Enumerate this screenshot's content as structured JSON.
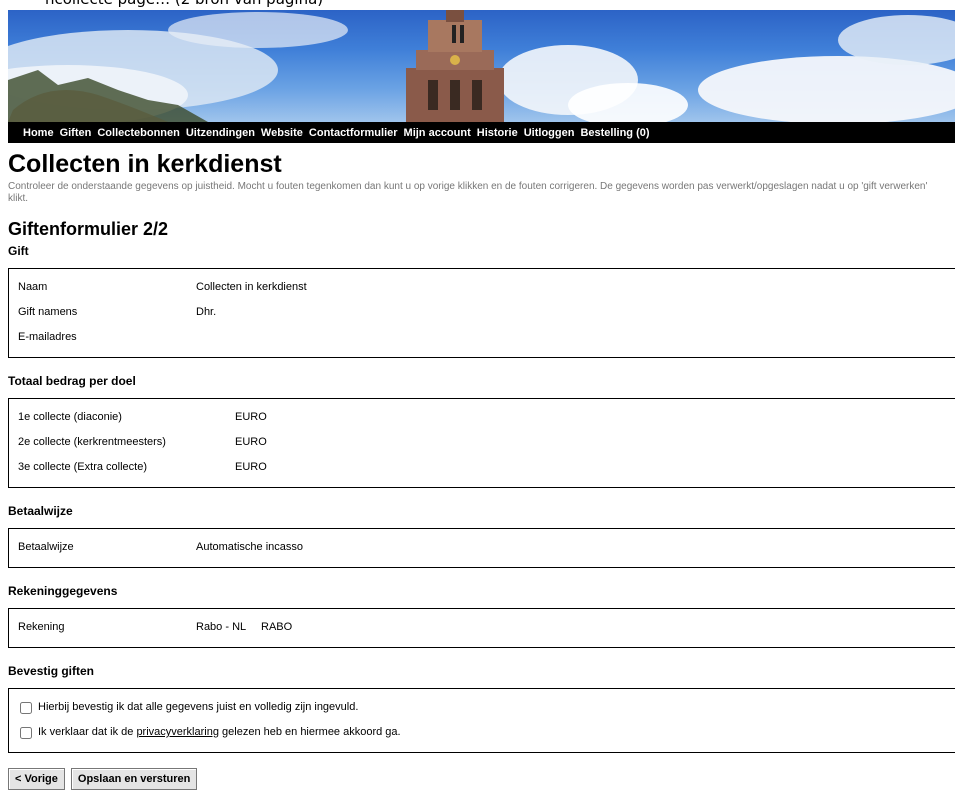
{
  "caption": "ncollecte page… (2 bron van pagina)",
  "nav": {
    "items": [
      "Home",
      "Giften",
      "Collectebonnen",
      "Uitzendingen",
      "Website",
      "Contactformulier",
      "Mijn account",
      "Historie",
      "Uitloggen",
      "Bestelling (0)"
    ]
  },
  "page": {
    "title": "Collecten in kerkdienst",
    "intro": "Controleer de onderstaande gegevens op juistheid. Mocht u fouten tegenkomen dan kunt u op vorige klikken en de fouten corrigeren. De gegevens worden pas verwerkt/opgeslagen nadat u op 'gift verwerken' klikt.",
    "form_title": "Giftenformulier 2/2"
  },
  "gift": {
    "title": "Gift",
    "rows": [
      {
        "label": "Naam",
        "value": "Collecten in kerkdienst"
      },
      {
        "label": "Gift namens",
        "value": "Dhr."
      },
      {
        "label": "E-mailadres",
        "value": ""
      }
    ]
  },
  "totaal": {
    "title": "Totaal bedrag per doel",
    "rows": [
      {
        "label": "1e collecte (diaconie)",
        "value": "EURO"
      },
      {
        "label": "2e collecte (kerkrentmeesters)",
        "value": "EURO"
      },
      {
        "label": "3e collecte (Extra collecte)",
        "value": "EURO"
      }
    ]
  },
  "betaalwijze": {
    "title": "Betaalwijze",
    "rows": [
      {
        "label": "Betaalwijze",
        "value": "Automatische incasso"
      }
    ]
  },
  "rekening": {
    "title": "Rekeninggegevens",
    "rows": [
      {
        "label": "Rekening",
        "value": "Rabo - NL     RABO"
      }
    ]
  },
  "bevestig": {
    "title": "Bevestig giften",
    "check1": "Hierbij bevestig ik dat alle gegevens juist en volledig zijn ingevuld.",
    "check2_pre": "Ik verklaar dat ik de ",
    "check2_link": "privacyverklaring",
    "check2_post": " gelezen heb en hiermee akkoord ga."
  },
  "buttons": {
    "prev": "< Vorige",
    "submit": "Opslaan en versturen"
  }
}
